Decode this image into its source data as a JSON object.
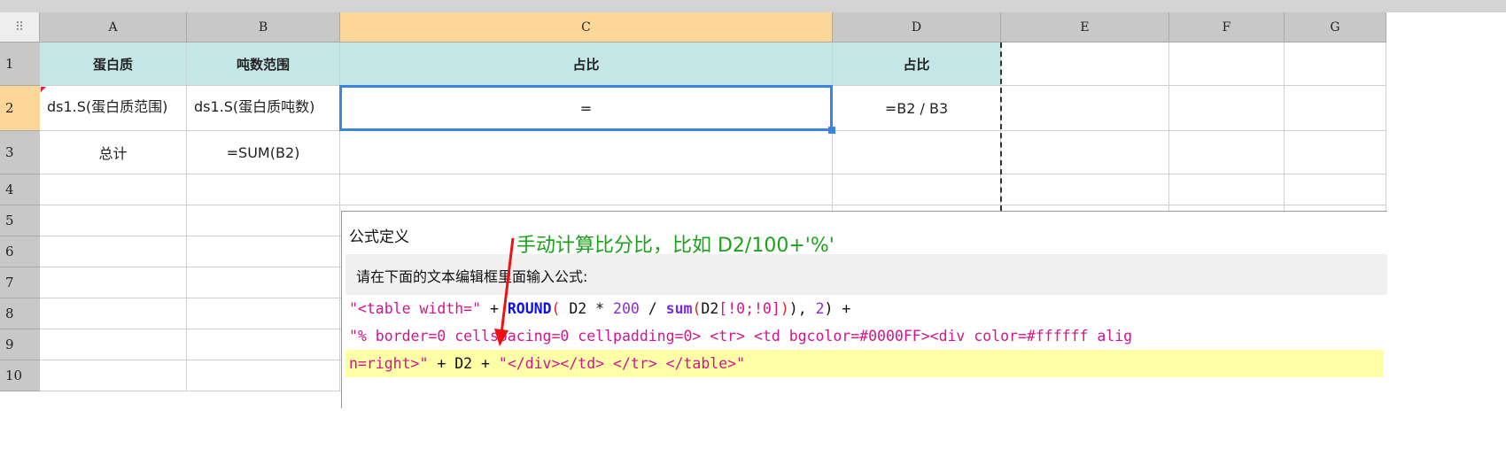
{
  "columns": [
    "A",
    "B",
    "C",
    "D",
    "E",
    "F",
    "G"
  ],
  "rows": [
    "1",
    "2",
    "3",
    "4",
    "5",
    "6",
    "7",
    "8",
    "9",
    "10"
  ],
  "cells": {
    "A1": "蛋白质",
    "B1": "吨数范围",
    "C1": "占比",
    "D1": "占比",
    "A2": "ds1.S(蛋白质范围)",
    "B2": "ds1.S(蛋白质吨数)",
    "C2": "=",
    "D2": "=B2 / B3",
    "A3": "总计",
    "B3": "=SUM(B2)"
  },
  "dialog": {
    "title": "公式定义",
    "annotation": "手动计算比分比，比如 D2/100+'%'",
    "instruction": "请在下面的文本编辑框里面输入公式:",
    "code": [
      [
        {
          "t": "\"<table width=\"",
          "c": "s"
        },
        {
          "t": " + ",
          "c": "k"
        },
        {
          "t": "ROUND",
          "c": "f"
        },
        {
          "t": "(",
          "c": "p"
        },
        {
          "t": " D2 * ",
          "c": "k"
        },
        {
          "t": "200",
          "c": "n"
        },
        {
          "t": " / ",
          "c": "k"
        },
        {
          "t": "sum",
          "c": "fn"
        },
        {
          "t": "(",
          "c": "p"
        },
        {
          "t": "D2",
          "c": "k"
        },
        {
          "t": "[!0;!0]",
          "c": "s"
        },
        {
          "t": ")",
          "c": "p"
        },
        {
          "t": "), ",
          "c": "k"
        },
        {
          "t": "2",
          "c": "n"
        },
        {
          "t": ") +",
          "c": "k"
        }
      ],
      [
        {
          "t": "\"% border=0 cellspacing=0 cellpadding=0> <tr> <td bgcolor=#0000FF><div color=#ffffff alig",
          "c": "s"
        }
      ],
      [
        {
          "t": "n=right>\"",
          "c": "s"
        },
        {
          "t": " + D2 + ",
          "c": "k"
        },
        {
          "t": "\"</div></td> </tr> </table>\"",
          "c": "s"
        }
      ]
    ]
  }
}
